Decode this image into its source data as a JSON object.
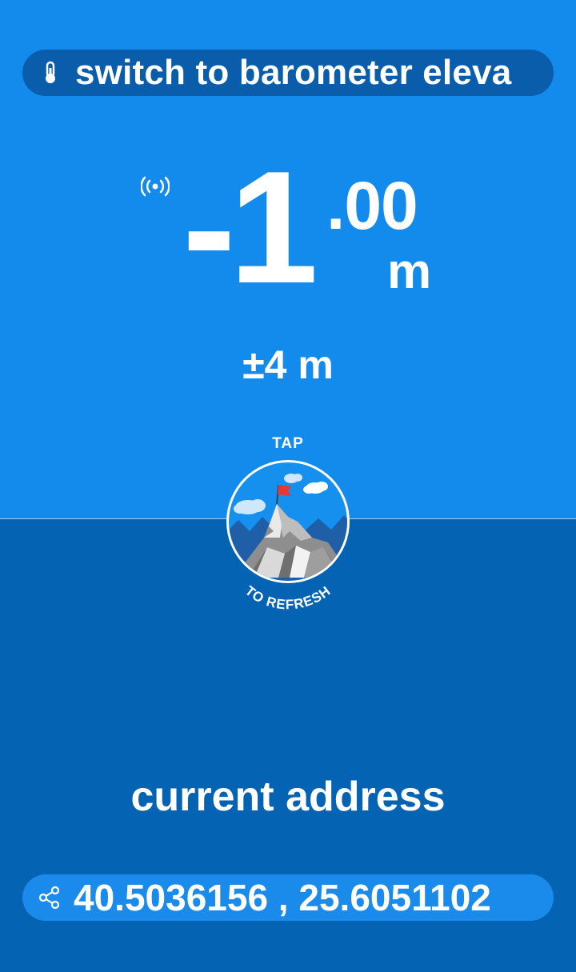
{
  "mode_pill": {
    "label": "switch to barometer eleva",
    "icon": "thermometer-icon"
  },
  "elevation": {
    "integer": "-1",
    "decimal": ".00",
    "unit": "m",
    "accuracy": "±4 m",
    "signal_icon": "gps-signal-icon"
  },
  "refresh": {
    "tap_label": "TAP",
    "to_refresh_label": "TO REFRESH"
  },
  "address": {
    "title": "current address",
    "coordinates": "40.5036156 , 25.6051102",
    "share_icon": "share-icon"
  },
  "colors": {
    "top_bg": "#128BEC",
    "bottom_bg": "#0563B4",
    "pill_dark": "#0A5DAA",
    "pill_light": "#1A8BEA",
    "flag": "#E53935"
  }
}
